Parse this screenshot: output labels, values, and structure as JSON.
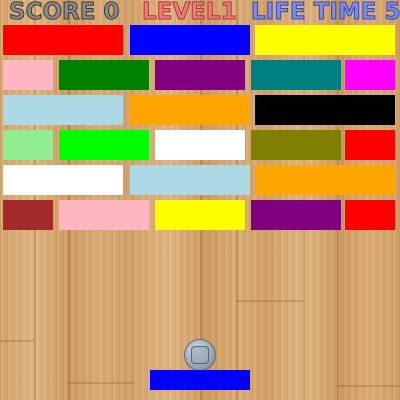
{
  "hud": {
    "score": "SCORE 0",
    "level": "LEVEL1",
    "life": "LIFE TIME 5"
  },
  "colors": {
    "paddle": "#0000ff",
    "score_text": "#8a8a8a",
    "level_text": "#f07a7a",
    "life_text": "#7d8be8",
    "floor": "#d9a873"
  },
  "bricks": [
    [
      "#ff0000",
      "#0000ff",
      "#ffff00"
    ],
    [
      "#ffb6c1",
      "#008000",
      "#800080",
      "#008080",
      "#ff00ff"
    ],
    [
      "#add8e6",
      "#ffa500",
      "#000000"
    ],
    [
      "#90ee90",
      "#00ff00",
      "#ffffff",
      "#808000",
      "#ff0000"
    ],
    [
      "#ffffff",
      "#add8e6",
      "#ffa500"
    ],
    [
      "#a52a2a",
      "#ffb6c1",
      "#ffff00",
      "#800080",
      "#ff0000"
    ]
  ],
  "ball": {
    "icon": "ball-icon"
  }
}
